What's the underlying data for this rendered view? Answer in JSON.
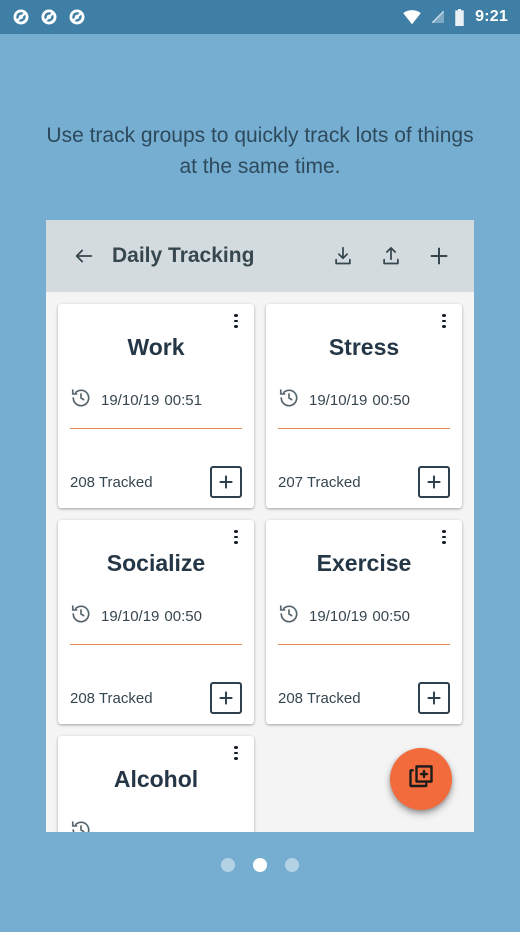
{
  "statusbar": {
    "notification_icons": [
      "app-notification-icon",
      "app-notification-icon",
      "app-notification-icon"
    ],
    "system_icons": [
      "wifi-icon",
      "no-signal-icon",
      "battery-icon"
    ],
    "time": "9:21",
    "background_color": "#3f7fa5"
  },
  "headline": {
    "text": "Use track groups to quickly track lots of things at the same time."
  },
  "app": {
    "toolbar": {
      "back_label": "back-arrow",
      "title": "Daily Tracking",
      "actions": [
        {
          "name": "download-icon",
          "label": "Download"
        },
        {
          "name": "upload-icon",
          "label": "Upload"
        },
        {
          "name": "plus-icon",
          "label": "Add"
        }
      ]
    },
    "cards": [
      {
        "title": "Work",
        "date": "19/10/19",
        "time": "00:51",
        "tracked": "208 Tracked",
        "menu": "more-options",
        "add": "add-entry"
      },
      {
        "title": "Stress",
        "date": "19/10/19",
        "time": "00:50",
        "tracked": "207 Tracked",
        "menu": "more-options",
        "add": "add-entry"
      },
      {
        "title": "Socialize",
        "date": "19/10/19",
        "time": "00:50",
        "tracked": "208 Tracked",
        "menu": "more-options",
        "add": "add-entry"
      },
      {
        "title": "Exercise",
        "date": "19/10/19",
        "time": "00:50",
        "tracked": "208 Tracked",
        "menu": "more-options",
        "add": "add-entry"
      },
      {
        "title": "Alcohol",
        "date": "",
        "time": "",
        "tracked": "",
        "menu": "more-options",
        "add": "add-entry"
      }
    ],
    "fab": {
      "name": "library-add-icon",
      "color": "#f26b3c"
    }
  },
  "pager": {
    "dots": [
      "inactive",
      "active",
      "inactive"
    ],
    "active_index": 1
  },
  "colors": {
    "page_background": "#76aed2",
    "statusbar": "#3f7fa5",
    "toolbar": "#d3dbde",
    "card": "#ffffff",
    "accent_rule": "#e08a66",
    "fab": "#f26b3c",
    "text_dark": "#253746"
  }
}
